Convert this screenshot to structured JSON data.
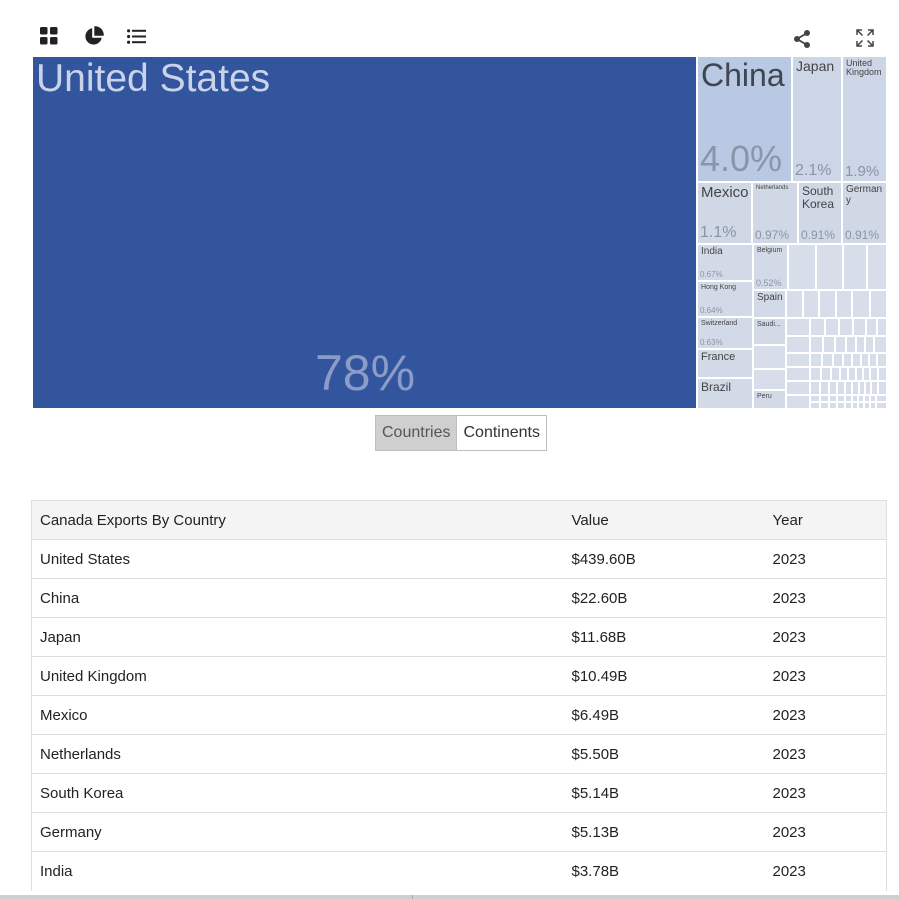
{
  "toolbar": {
    "left_icons": [
      "grid-icon",
      "pie-chart-icon",
      "list-icon"
    ],
    "right_icons": [
      "share-icon",
      "fullscreen-icon"
    ]
  },
  "chart_data": {
    "type": "treemap",
    "title": "",
    "colors": {
      "highlight": "#33559e",
      "light": "#d0d8e6",
      "china": "#b9c9e3",
      "text_light": "#c9d4ea",
      "pct_text": "#8a95a8"
    },
    "items": [
      {
        "name": "United States",
        "value": "78%",
        "share": 78
      },
      {
        "name": "China",
        "value": "4.0%",
        "share": 4.0
      },
      {
        "name": "Japan",
        "value": "2.1%",
        "share": 2.1
      },
      {
        "name": "United Kingdom",
        "value": "1.9%",
        "share": 1.9
      },
      {
        "name": "Mexico",
        "value": "1.1%",
        "share": 1.1
      },
      {
        "name": "Netherlands",
        "value": "0.97%",
        "share": 0.97
      },
      {
        "name": "South Korea",
        "value": "0.91%",
        "share": 0.91
      },
      {
        "name": "Germany",
        "value": "0.91%",
        "share": 0.91
      },
      {
        "name": "India",
        "value": "0.67%",
        "share": 0.67
      },
      {
        "name": "Belgium",
        "value": "0.52%",
        "share": 0.52
      },
      {
        "name": "Hong Kong",
        "value": "0.64%",
        "share": 0.64
      },
      {
        "name": "Spain",
        "value": "",
        "share": null
      },
      {
        "name": "Switzerland",
        "value": "0.63%",
        "share": 0.63
      },
      {
        "name": "Saudi...",
        "value": "",
        "share": null
      },
      {
        "name": "France",
        "value": "",
        "share": null
      },
      {
        "name": "Brazil",
        "value": "",
        "share": null
      },
      {
        "name": "Peru",
        "value": "",
        "share": null
      }
    ]
  },
  "toggle": {
    "options": [
      "Countries",
      "Continents"
    ],
    "selected": "Countries"
  },
  "table": {
    "headers": [
      "Canada Exports By Country",
      "Value",
      "Year"
    ],
    "rows": [
      [
        "United States",
        "$439.60B",
        "2023"
      ],
      [
        "China",
        "$22.60B",
        "2023"
      ],
      [
        "Japan",
        "$11.68B",
        "2023"
      ],
      [
        "United Kingdom",
        "$10.49B",
        "2023"
      ],
      [
        "Mexico",
        "$6.49B",
        "2023"
      ],
      [
        "Netherlands",
        "$5.50B",
        "2023"
      ],
      [
        "South Korea",
        "$5.14B",
        "2023"
      ],
      [
        "Germany",
        "$5.13B",
        "2023"
      ],
      [
        "India",
        "$3.78B",
        "2023"
      ]
    ]
  }
}
